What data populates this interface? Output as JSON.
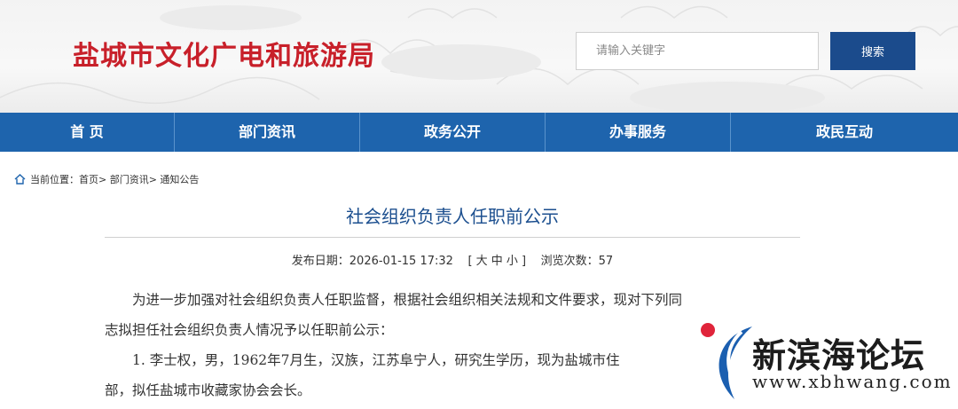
{
  "header": {
    "site_title": "盐城市文化广电和旅游局",
    "search_placeholder": "请输入关键字",
    "search_button": "搜索"
  },
  "nav": {
    "items": [
      "首 页",
      "部门资讯",
      "政务公开",
      "办事服务",
      "政民互动"
    ]
  },
  "breadcrumb": {
    "prefix": "当前位置：",
    "path": "首页> 部门资讯> 通知公告"
  },
  "article": {
    "title": "社会组织负责人任职前公示",
    "meta": "发布日期：2026-01-15 17:32    [ 大 中 小 ]    浏览次数：57",
    "lines": [
      "　　为进一步加强对社会组织负责人任职监督，根据社会组织相关法规和文件要求，现对下列同",
      "志拟担任社会组织负责人情况予以任职前公示：",
      "　　1. 李士权，男，1962年7月生，汉族，江苏阜宁人，研究生学历，现为盐城市住",
      "部，拟任盐城市收藏家协会会长。"
    ]
  },
  "watermark": {
    "name": "新滨海论坛",
    "url": "www.xbhwang.com"
  }
}
